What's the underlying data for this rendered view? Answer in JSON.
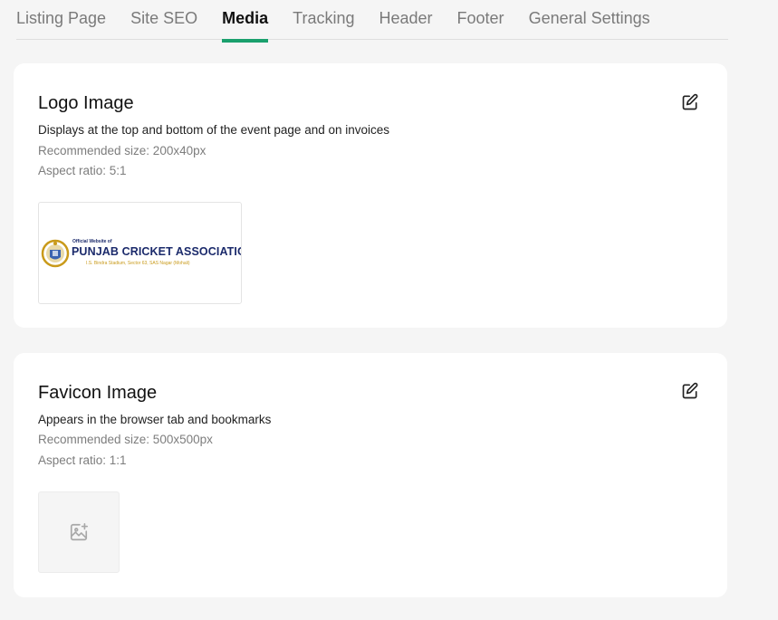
{
  "tabs": [
    {
      "label": "Listing Page",
      "active": false
    },
    {
      "label": "Site SEO",
      "active": false
    },
    {
      "label": "Media",
      "active": true
    },
    {
      "label": "Tracking",
      "active": false
    },
    {
      "label": "Header",
      "active": false
    },
    {
      "label": "Footer",
      "active": false
    },
    {
      "label": "General Settings",
      "active": false
    }
  ],
  "logo": {
    "title": "Logo Image",
    "description": "Displays at the top and bottom of the event page and on invoices",
    "recommended": "Recommended size: 200x40px",
    "aspect": "Aspect ratio: 5:1",
    "image": {
      "small_text": "Official Website of",
      "main_text": "PUNJAB CRICKET ASSOCIATION",
      "address_text": "I.S. Bindra Stadium, Sector 63, SAS Nagar (Mohali)"
    }
  },
  "favicon": {
    "title": "Favicon Image",
    "description": "Appears in the browser tab and bookmarks",
    "recommended": "Recommended size: 500x500px",
    "aspect": "Aspect ratio: 1:1"
  },
  "colors": {
    "accent": "#1aa06d",
    "logo_navy": "#1b2a6b",
    "logo_gold": "#c99a1a"
  },
  "icons": {
    "edit": "edit-icon",
    "image_placeholder": "image-add-icon"
  }
}
